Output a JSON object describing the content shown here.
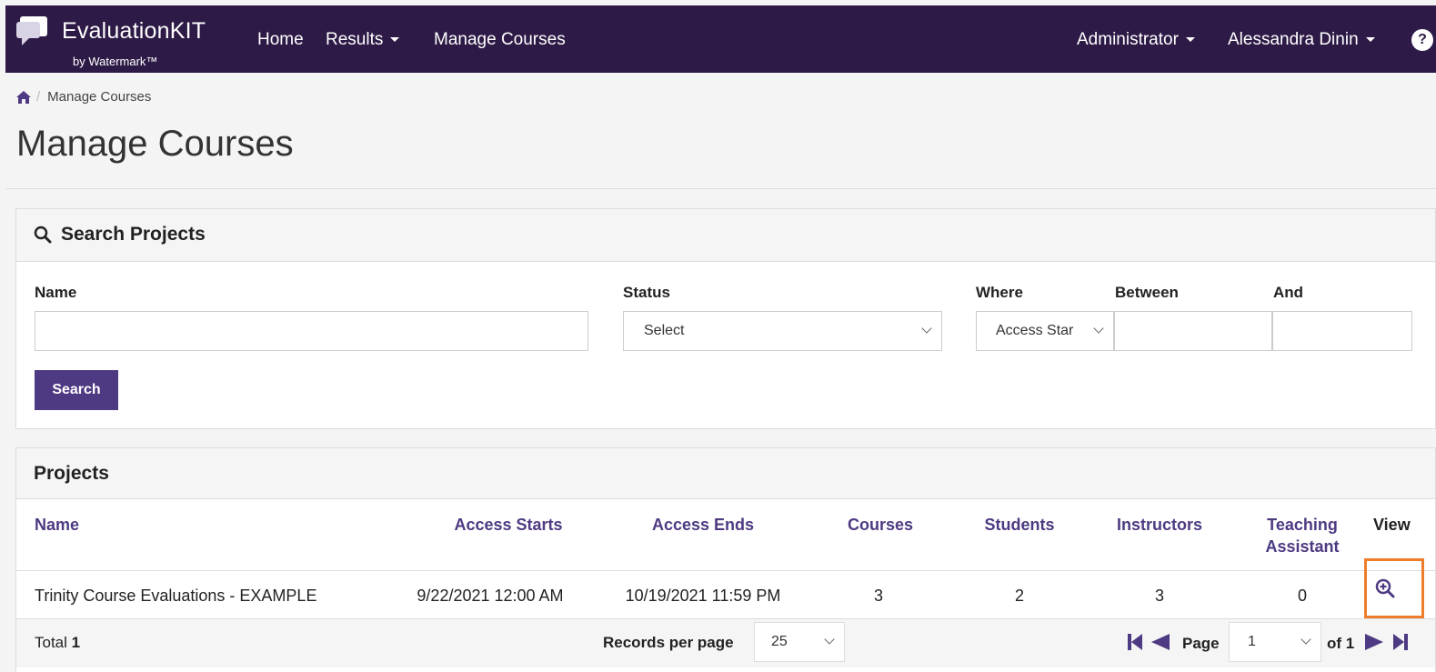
{
  "brand": {
    "name": "EvaluationKIT",
    "sub": "by Watermark™"
  },
  "nav": {
    "home": "Home",
    "results": "Results",
    "manage_courses": "Manage Courses",
    "administrator": "Administrator",
    "user": "Alessandra Dinin",
    "help": "?"
  },
  "breadcrumb": {
    "current": "Manage Courses"
  },
  "page": {
    "title": "Manage Courses"
  },
  "search_panel": {
    "title": "Search Projects",
    "labels": {
      "name": "Name",
      "status": "Status",
      "where": "Where",
      "between": "Between",
      "and": "And"
    },
    "name_value": "",
    "status_value": "Select",
    "where_value": "Access Star",
    "between_value": "",
    "and_value": "",
    "search_button": "Search"
  },
  "projects_panel": {
    "title": "Projects",
    "columns": {
      "name": "Name",
      "access_starts": "Access Starts",
      "access_ends": "Access Ends",
      "courses": "Courses",
      "students": "Students",
      "instructors": "Instructors",
      "teaching_assistant_line1": "Teaching",
      "teaching_assistant_line2": "Assistant",
      "view": "View"
    },
    "rows": [
      {
        "name": "Trinity Course Evaluations - EXAMPLE",
        "access_starts": "9/22/2021 12:00 AM",
        "access_ends": "10/19/2021 11:59 PM",
        "courses": "3",
        "students": "2",
        "instructors": "3",
        "teaching_assistant": "0"
      }
    ],
    "footer": {
      "total_label": "Total",
      "total_value": "1",
      "records_per_page_label": "Records per page",
      "records_per_page_value": "25",
      "page_label": "Page",
      "page_value": "1",
      "of_label": "of 1"
    }
  },
  "colors": {
    "nav_bg": "#2d1a46",
    "accent": "#4e3a82",
    "highlight": "#ee7d2b"
  }
}
